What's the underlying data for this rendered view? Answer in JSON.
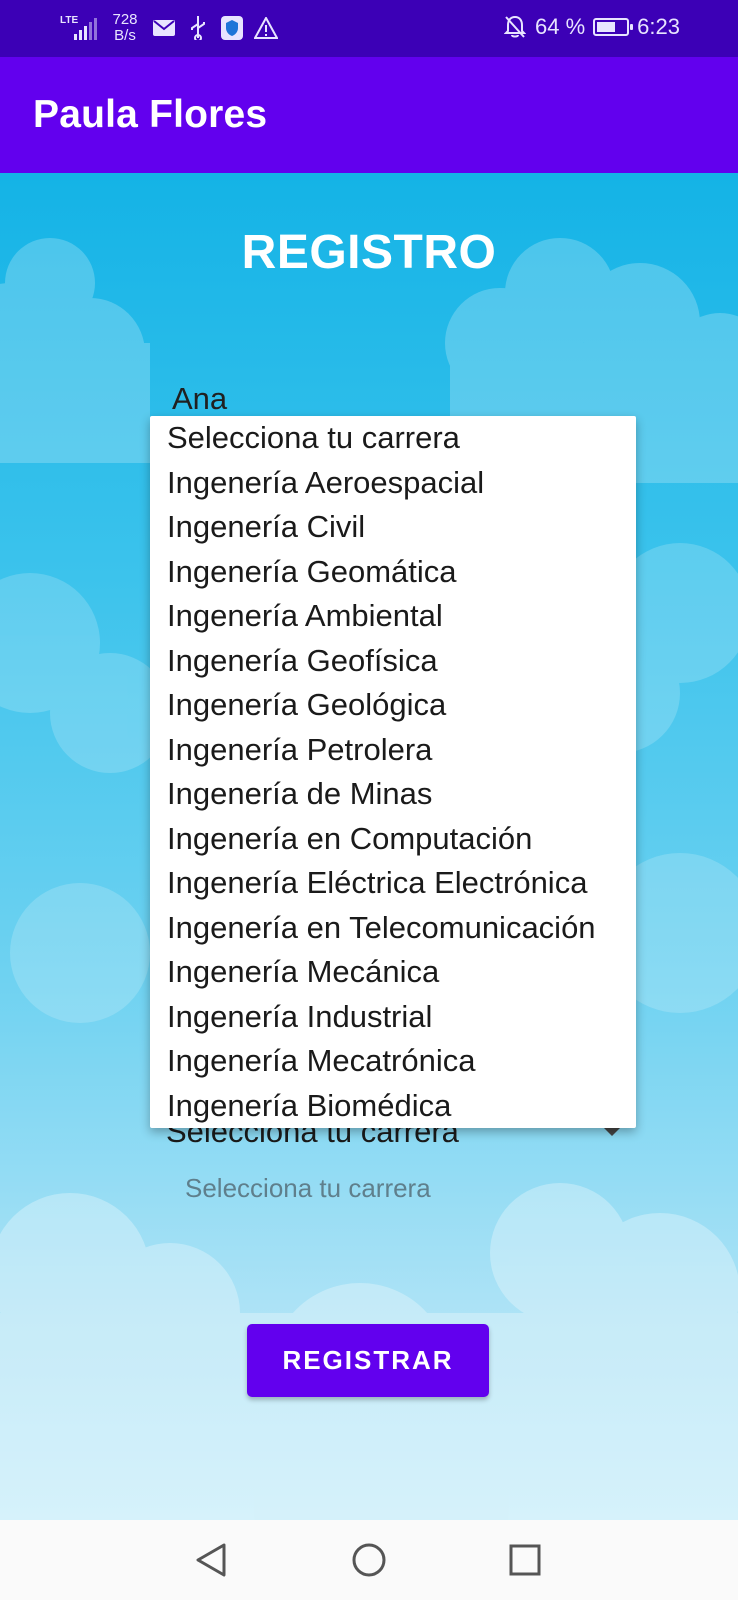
{
  "status_bar": {
    "network_type": "LTE",
    "speed_value": "728",
    "speed_unit": "B/s",
    "battery_percent": "64 %",
    "battery_level": 0.64,
    "time": "6:23",
    "icons": [
      "mail-icon",
      "usb-icon",
      "shield-icon",
      "warning-icon",
      "notifications-off-icon",
      "battery-charging-icon"
    ]
  },
  "app_bar": {
    "title": "Paula Flores"
  },
  "form": {
    "heading": "REGISTRO",
    "name_value": "Ana",
    "career_spinner": {
      "selected": "Selecciona tu carrera"
    },
    "career_helper": "Selecciona tu carrera",
    "register_label": "REGISTRAR"
  },
  "dropdown": {
    "options": [
      "Selecciona tu carrera",
      "Ingenería Aeroespacial",
      "Ingenería Civil",
      "Ingenería Geomática",
      "Ingenería Ambiental",
      "Ingenería Geofísica",
      "Ingenería Geológica",
      "Ingenería Petrolera",
      "Ingenería de Minas",
      "Ingenería en Computación",
      "Ingenería Eléctrica Electrónica",
      "Ingenería en Telecomunicación",
      "Ingenería Mecánica",
      "Ingenería Industrial",
      "Ingenería Mecatrónica",
      "Ingenería Biomédica"
    ]
  },
  "colors": {
    "status_bar": "#3c00b6",
    "app_bar": "#6200ee",
    "button": "#6200ee",
    "sky": "#3cc3ec"
  }
}
